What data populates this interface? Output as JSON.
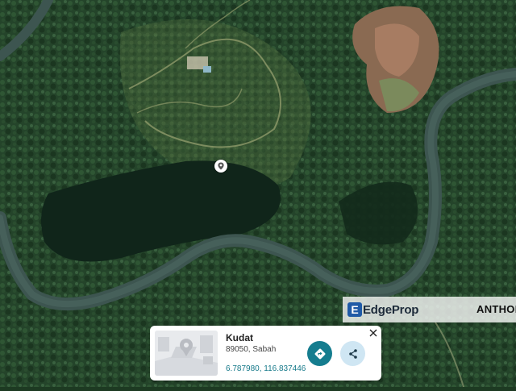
{
  "map": {
    "view": "satellite",
    "pin_icon": "location-pin-icon"
  },
  "watermark": {
    "brand": "EdgeProp",
    "brand_initial": "E",
    "agent_name": "ANTHON"
  },
  "location_card": {
    "title": "Kudat",
    "subtitle": "89050, Sabah",
    "coordinates": "6.787980, 116.837446",
    "directions_icon": "directions-icon",
    "share_icon": "share-icon",
    "close_icon": "close-icon",
    "accent_color": "#157d8f"
  }
}
